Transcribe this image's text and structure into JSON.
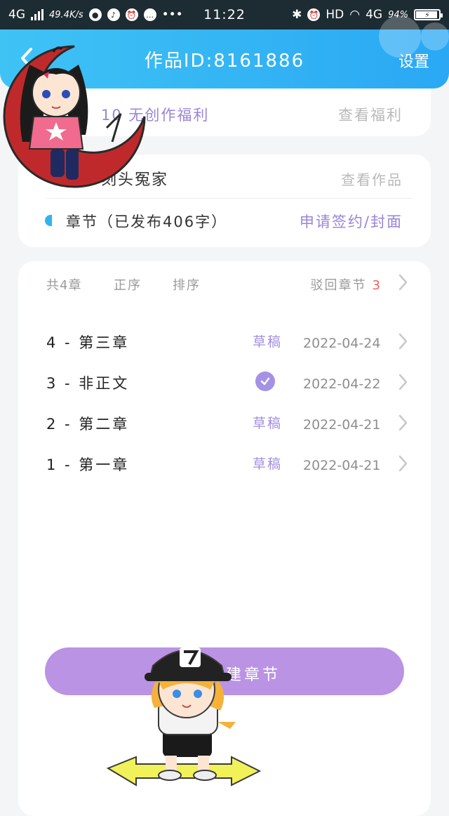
{
  "status_bar": {
    "network": "4G",
    "speed": "49.4K/s",
    "time": "11:22",
    "hd": "HD",
    "network2": "4G",
    "battery": "94%"
  },
  "header": {
    "title": "作品ID:8161886",
    "settings_label": "设置"
  },
  "welfare": {
    "label": "10 无创作福利",
    "view_label": "查看福利"
  },
  "work": {
    "title": "刻头冤家",
    "view_label": "查看作品",
    "chapter_count": "章节（已发布406字）",
    "apply_label": "申请签约/封面"
  },
  "chapters_toolbar": {
    "count": "共4章",
    "order": "正序",
    "sort": "排序",
    "rejected_label": "驳回章节",
    "rejected_count": "3"
  },
  "chapters": [
    {
      "title": "4 - 第三章",
      "status": "草稿",
      "date": "2022-04-24"
    },
    {
      "title": "3 - 非正文",
      "status": "",
      "date": "2022-04-22"
    },
    {
      "title": "2 - 第二章",
      "status": "草稿",
      "date": "2022-04-21"
    },
    {
      "title": "1 - 第一章",
      "status": "草稿",
      "date": "2022-04-21"
    }
  ],
  "new_chapter_label": "建章节",
  "colors": {
    "header": "#2aa8f4",
    "accent": "#9a84d9",
    "button": "#ba93e4",
    "rejected": "#f06060"
  }
}
